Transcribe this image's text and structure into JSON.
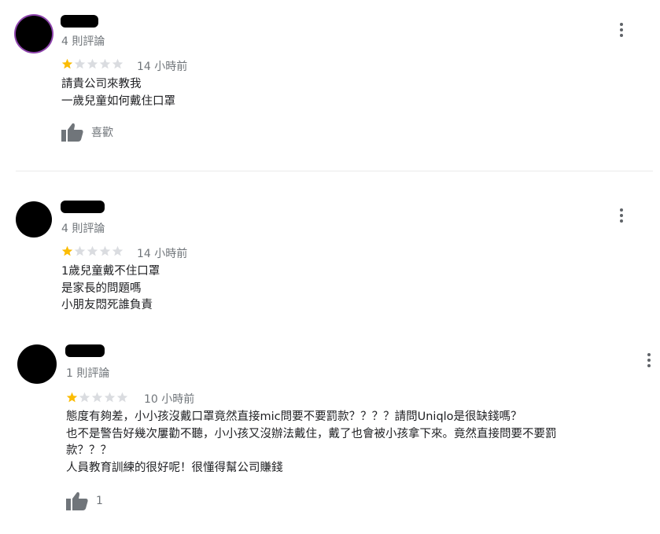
{
  "reviews": [
    {
      "review_count": "4 則評論",
      "rating": 1,
      "time": "14 小時前",
      "lines": [
        "請貴公司來教我",
        "一歲兒童如何戴住口罩"
      ],
      "like_label": "喜歡"
    },
    {
      "review_count": "4 則評論",
      "rating": 1,
      "time": "14 小時前",
      "lines": [
        "1歲兒童戴不住口罩",
        "是家長的問題嗎",
        "小朋友悶死誰負責"
      ],
      "like_label": ""
    },
    {
      "review_count": "1 則評論",
      "rating": 1,
      "time": "10 小時前",
      "lines": [
        "態度有夠差，小小孩沒戴口罩竟然直接mic問要不要罰款？？？？請問Uniqlo是很缺錢嗎？",
        "也不是警告好幾次屢勸不聽，小小孩又沒辦法戴住，戴了也會被小孩拿下來。竟然直接問要不要罰",
        "款？？？",
        "人員教育訓練的很好呢！很懂得幫公司賺錢"
      ],
      "like_label": "1"
    }
  ],
  "icons": {
    "like": "thumbs-up-icon",
    "more": "more-vert-icon",
    "star_filled": "star-filled-icon",
    "star_empty": "star-empty-icon"
  },
  "colors": {
    "star_filled": "#fbbc04",
    "star_empty": "#dadce0",
    "thumb": "#70757a",
    "avatar_ring": "#8e44ad"
  }
}
